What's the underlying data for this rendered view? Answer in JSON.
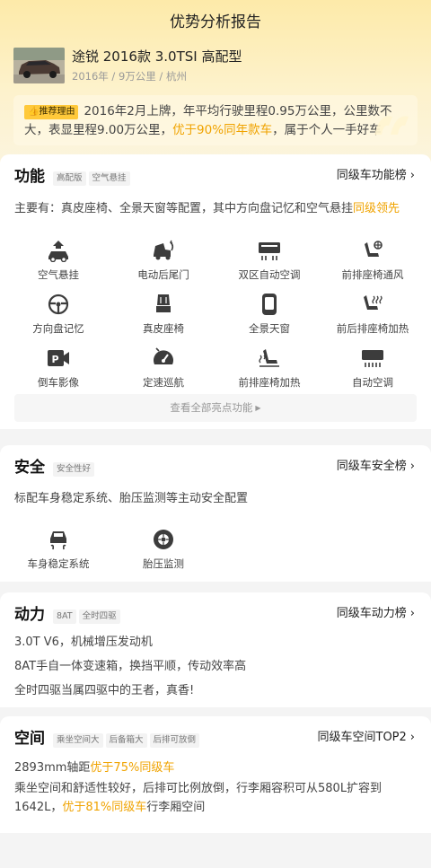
{
  "header": {
    "title": "优势分析报告"
  },
  "car": {
    "name": "途锐 2016款 3.0TSI 高配型",
    "meta": "2016年 / 9万公里 / 杭州"
  },
  "reason": {
    "tag": "推荐理由",
    "text_1": "2016年2月上牌，年平均行驶里程0.95万公里，公里数不大，表显里程9.00万公里，",
    "highlight": "优于90%同年款车",
    "text_2": "，属于个人一手好车"
  },
  "function_section": {
    "title": "功能",
    "tags": [
      "高配版",
      "空气悬挂"
    ],
    "rank_label": "同级车功能榜",
    "summary_prefix": "主要有：真皮座椅、全景天窗等配置，其中方向盘记忆和空气悬挂",
    "summary_highlight": "同级领先",
    "features": [
      {
        "label": "空气悬挂",
        "icon": "air-suspension-icon"
      },
      {
        "label": "电动后尾门",
        "icon": "power-tailgate-icon"
      },
      {
        "label": "双区自动空调",
        "icon": "dual-zone-ac-icon"
      },
      {
        "label": "前排座椅通风",
        "icon": "seat-ventilation-icon"
      },
      {
        "label": "方向盘记忆",
        "icon": "steering-memory-icon"
      },
      {
        "label": "真皮座椅",
        "icon": "leather-seat-icon"
      },
      {
        "label": "全景天窗",
        "icon": "panoramic-sunroof-icon"
      },
      {
        "label": "前后排座椅加热",
        "icon": "seat-heating-front-rear-icon"
      },
      {
        "label": "倒车影像",
        "icon": "reverse-camera-icon"
      },
      {
        "label": "定速巡航",
        "icon": "cruise-control-icon"
      },
      {
        "label": "前排座椅加热",
        "icon": "front-seat-heating-icon"
      },
      {
        "label": "自动空调",
        "icon": "auto-ac-icon"
      }
    ],
    "view_all": "查看全部亮点功能"
  },
  "safety_section": {
    "title": "安全",
    "tags": [
      "安全性好"
    ],
    "rank_label": "同级车安全榜",
    "summary": "标配车身稳定系统、胎压监测等主动安全配置",
    "features": [
      {
        "label": "车身稳定系统",
        "icon": "stability-control-icon"
      },
      {
        "label": "胎压监测",
        "icon": "tire-pressure-icon"
      }
    ]
  },
  "power_section": {
    "title": "动力",
    "tags": [
      "8AT",
      "全时四驱"
    ],
    "rank_label": "同级车动力榜",
    "lines": [
      "3.0T V6，机械增压发动机",
      "8AT手自一体变速箱，换挡平顺，传动效率高",
      "全时四驱当属四驱中的王者，真香!"
    ]
  },
  "space_section": {
    "title": "空间",
    "tags": [
      "乘坐空间大",
      "后备箱大",
      "后排可放倒"
    ],
    "rank_label": "同级车空间TOP2",
    "line1_prefix": "2893mm轴距",
    "line1_highlight": "优于75%同级车",
    "para_text": "乘坐空间和舒适性较好，后排可比例放倒，行李厢容积可从580L扩容到1642L，",
    "para_highlight": "优于81%同级车",
    "para_suffix": "行李厢空间"
  },
  "colors": {
    "accent": "#f0a300",
    "tag_yellow": "#ffc93a",
    "header_gradient_top": "#fdeaa9"
  }
}
